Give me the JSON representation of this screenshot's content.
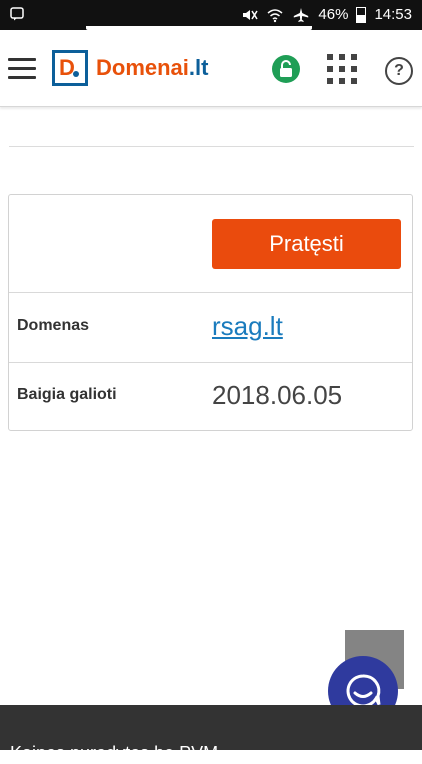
{
  "status_bar": {
    "battery": "46%",
    "time": "14:53"
  },
  "header": {
    "logo_mark": "D",
    "logo_name": "Domenai",
    "logo_tld": ".lt"
  },
  "card": {
    "button_label": "Pratęsti",
    "rows": [
      {
        "label": "Domenas",
        "value": "rsag.lt"
      },
      {
        "label": "Baigia galioti",
        "value": "2018.06.05"
      }
    ]
  },
  "footer": {
    "text": "Kainos nurodytos be PVM"
  }
}
